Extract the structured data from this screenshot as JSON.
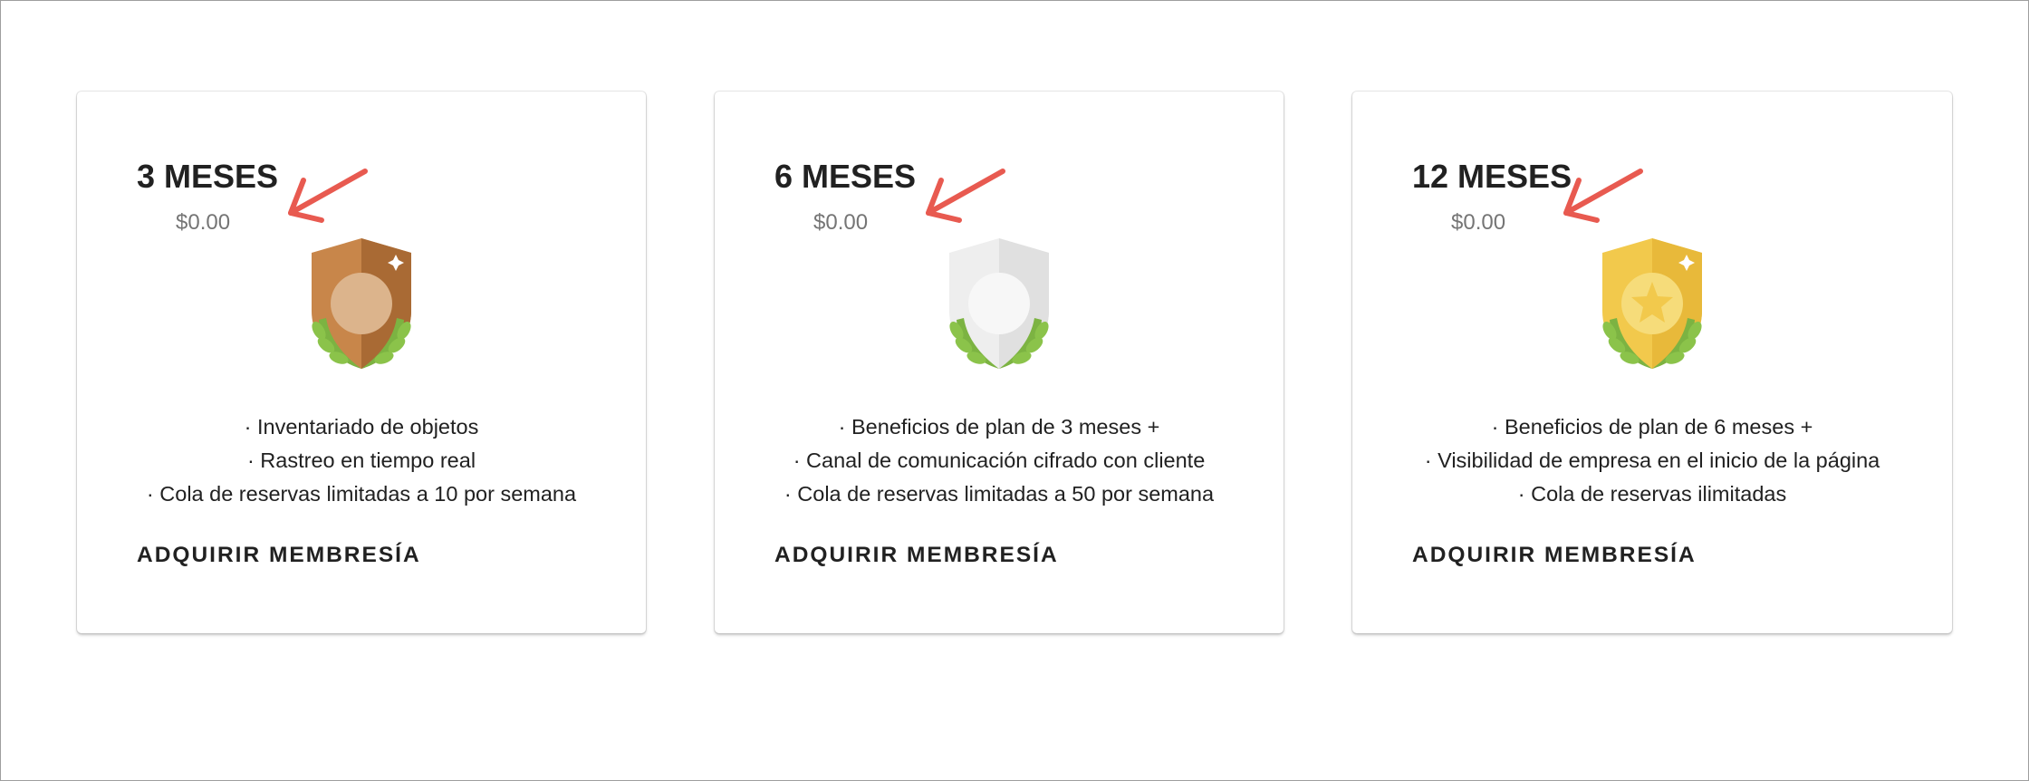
{
  "plans": [
    {
      "title": "3 MESES",
      "price": "$0.00",
      "badge_icon": "bronze-shield-laurel-icon",
      "benefits": [
        "· Inventariado de objetos",
        "· Rastreo en tiempo real",
        "· Cola de reservas limitadas a 10 por semana"
      ],
      "cta_label": "ADQUIRIR MEMBRESÍA"
    },
    {
      "title": "6 MESES",
      "price": "$0.00",
      "badge_icon": "silver-shield-laurel-icon",
      "benefits": [
        "· Beneficios de plan de 3 meses +",
        "· Canal de comunicación cifrado con cliente",
        "· Cola de reservas limitadas a 50 por semana"
      ],
      "cta_label": "ADQUIRIR MEMBRESÍA"
    },
    {
      "title": "12 MESES",
      "price": "$0.00",
      "badge_icon": "gold-shield-laurel-icon",
      "benefits": [
        "· Beneficios de plan de 6 meses +",
        "· Visibilidad de empresa en el inicio de la página",
        "· Cola de reservas ilimitadas"
      ],
      "cta_label": "ADQUIRIR MEMBRESÍA"
    }
  ],
  "annotation": {
    "arrow_icon": "red-arrow-icon",
    "color": "#e85a50"
  },
  "colors": {
    "bronze": "#c8864a",
    "silver": "#e6e6e6",
    "gold": "#f2c94c",
    "laurel": "#7cb342",
    "price_text": "#757575"
  }
}
